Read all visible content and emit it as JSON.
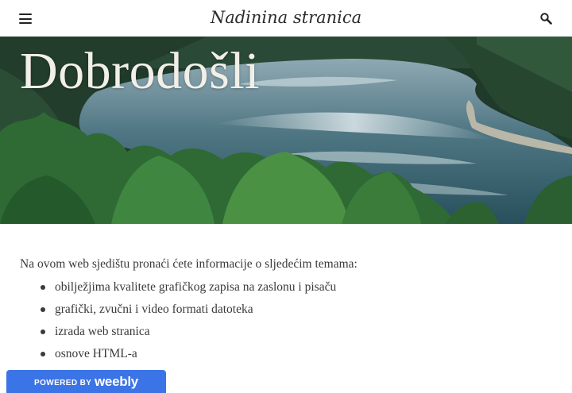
{
  "header": {
    "site_title": "Nadinina stranica",
    "menu_icon": "hamburger-icon",
    "search_icon": "search-icon"
  },
  "hero": {
    "title": "Dobrodošli",
    "image": "forest-lake-photo"
  },
  "content": {
    "intro": "Na ovom web sjedištu pronaći ćete informacije o sljedećim temama:",
    "topics": [
      "obilježjima kvalitete grafičkog zapisa na zaslonu i pisaču",
      "grafički, zvučni i video formati datoteka",
      "izrada web stranica",
      "osnove HTML-a"
    ]
  },
  "badge": {
    "prefix": "POWERED BY",
    "brand": "weebly",
    "color": "#3b74e6"
  }
}
